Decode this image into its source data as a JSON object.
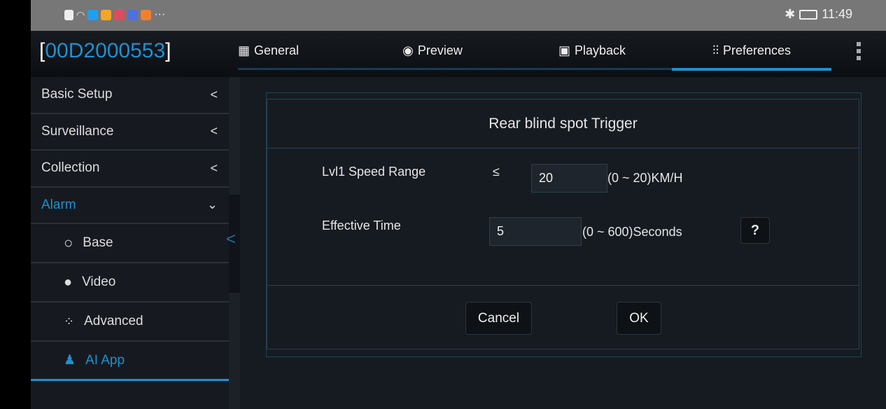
{
  "status_bar": {
    "time": "11:49",
    "icons": [
      "alert-icon",
      "wifi-icon",
      "search-app-icon",
      "shield-app-icon",
      "book-app-icon",
      "music-app-icon",
      "video-app-icon",
      "more-icon",
      "bluetooth-icon",
      "battery-charging-icon"
    ],
    "more": "···"
  },
  "header": {
    "device_id": "00D2000553",
    "tabs": [
      {
        "label": "General",
        "icon": "grid-icon"
      },
      {
        "label": "Preview",
        "icon": "eye-icon"
      },
      {
        "label": "Playback",
        "icon": "film-icon"
      },
      {
        "label": "Preferences",
        "icon": "sliders-icon",
        "selected": true
      }
    ]
  },
  "sidebar": {
    "items": [
      {
        "label": "Basic Setup"
      },
      {
        "label": "Surveillance"
      },
      {
        "label": "Collection"
      },
      {
        "label": "Alarm",
        "expanded": true
      }
    ],
    "sub_items": [
      {
        "label": "Base",
        "icon": "circle-icon"
      },
      {
        "label": "Video",
        "icon": "globe-icon"
      },
      {
        "label": "Advanced",
        "icon": "dots-spinner-icon"
      },
      {
        "label": "AI App",
        "icon": "doctor-icon",
        "selected": true
      }
    ]
  },
  "dialog": {
    "title": "Rear blind spot Trigger",
    "speed": {
      "label": "Lvl1 Speed Range",
      "operator": "≤",
      "value": "20",
      "range": "(0 ~ 20)KM/H"
    },
    "time": {
      "label": "Effective Time",
      "value": "5",
      "range": "(0 ~ 600)Seconds"
    },
    "help": "?",
    "cancel": "Cancel",
    "ok": "OK"
  },
  "colors": {
    "accent": "#1e90d0",
    "background": "#161b21"
  }
}
